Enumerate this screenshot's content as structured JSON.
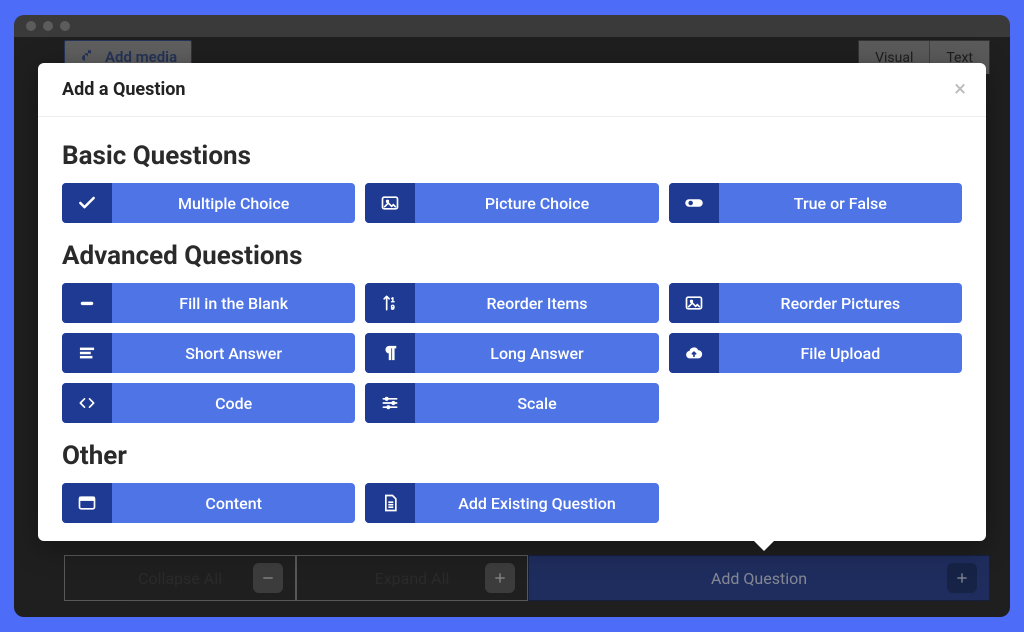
{
  "background": {
    "add_media": "Add media",
    "view_tabs": [
      "Visual",
      "Text"
    ]
  },
  "modal": {
    "title": "Add a Question",
    "sections": [
      {
        "title": "Basic Questions",
        "items": [
          {
            "icon": "check",
            "label": "Multiple Choice"
          },
          {
            "icon": "image",
            "label": "Picture Choice"
          },
          {
            "icon": "toggle",
            "label": "True or False"
          }
        ]
      },
      {
        "title": "Advanced Questions",
        "items": [
          {
            "icon": "minus",
            "label": "Fill in the Blank"
          },
          {
            "icon": "reorder",
            "label": "Reorder Items"
          },
          {
            "icon": "image",
            "label": "Reorder Pictures"
          },
          {
            "icon": "lines",
            "label": "Short Answer"
          },
          {
            "icon": "paragraph",
            "label": "Long Answer"
          },
          {
            "icon": "cloud-up",
            "label": "File Upload"
          },
          {
            "icon": "code",
            "label": "Code"
          },
          {
            "icon": "sliders",
            "label": "Scale"
          }
        ]
      },
      {
        "title": "Other",
        "items": [
          {
            "icon": "panel",
            "label": "Content"
          },
          {
            "icon": "doc",
            "label": "Add Existing Question"
          }
        ]
      }
    ]
  },
  "bottom": {
    "collapse": "Collapse All",
    "expand": "Expand All",
    "add_question": "Add Question"
  }
}
